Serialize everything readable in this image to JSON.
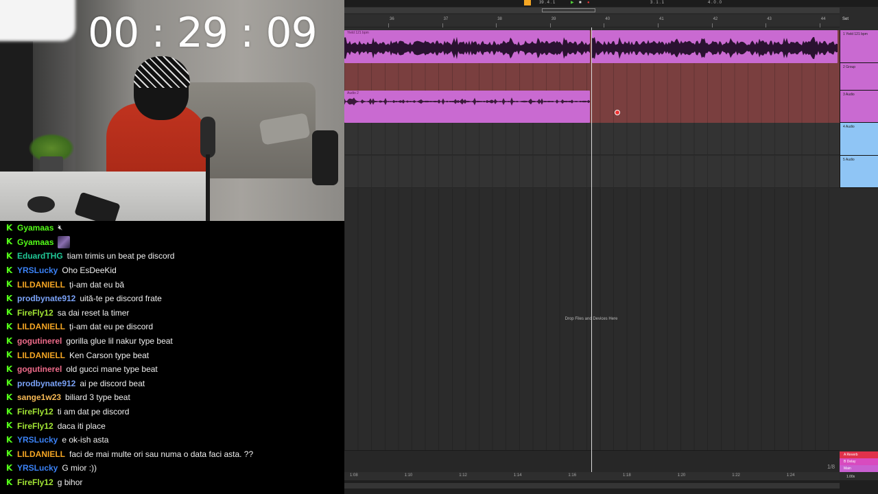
{
  "timer": "00 : 29 : 09",
  "chat": {
    "messages": [
      {
        "user": "Gyamaas",
        "color": "#53fc18",
        "text": "",
        "emote": "mute-icon"
      },
      {
        "user": "Gyamaas",
        "color": "#53fc18",
        "text": "",
        "emote": "emote-image"
      },
      {
        "user": "EduardTHG",
        "color": "#20c997",
        "text": "tiam trimis un beat pe discord"
      },
      {
        "user": "YRSLucky",
        "color": "#3b82f6",
        "text": "Oho EsDeeKid"
      },
      {
        "user": "LILDANIELL",
        "color": "#f5a623",
        "text": "ți-am dat eu bă"
      },
      {
        "user": "prodbynate912",
        "color": "#7aa2f7",
        "text": "uită-te pe discord frate"
      },
      {
        "user": "FireFly12",
        "color": "#a3e635",
        "text": "sa dai reset la timer"
      },
      {
        "user": "LILDANIELL",
        "color": "#f5a623",
        "text": "ți-am dat eu pe discord"
      },
      {
        "user": "gogutinerel",
        "color": "#ef6b8a",
        "text": "gorilla glue lil nakur type beat"
      },
      {
        "user": "LILDANIELL",
        "color": "#f5a623",
        "text": "Ken Carson type beat"
      },
      {
        "user": "gogutinerel",
        "color": "#ef6b8a",
        "text": "old gucci mane type beat"
      },
      {
        "user": "prodbynate912",
        "color": "#7aa2f7",
        "text": "ai pe discord beat"
      },
      {
        "user": "sange1w23",
        "color": "#f7b955",
        "text": "biliard 3 type beat"
      },
      {
        "user": "FireFly12",
        "color": "#a3e635",
        "text": "ti am dat pe discord"
      },
      {
        "user": "FireFly12",
        "color": "#a3e635",
        "text": "daca iti place"
      },
      {
        "user": "YRSLucky",
        "color": "#3b82f6",
        "text": "e ok-ish asta"
      },
      {
        "user": "LILDANIELL",
        "color": "#f5a623",
        "text": "faci de mai multe ori sau numa o data faci asta. ??"
      },
      {
        "user": "YRSLucky",
        "color": "#3b82f6",
        "text": "G mior :))"
      },
      {
        "user": "FireFly12",
        "color": "#a3e635",
        "text": "g bihor"
      }
    ]
  },
  "daw": {
    "transport": {
      "position": "39 . 4 . 1",
      "loop_start": "3 . 1 . 1",
      "loop_end": "4 . 0 . 0"
    },
    "ruler": [
      "36",
      "37",
      "38",
      "39",
      "40",
      "41",
      "42",
      "43",
      "44"
    ],
    "set_label": "Set",
    "tracks": [
      {
        "name": "1 Yield 121 bpm",
        "clip": "Yield 121 bpm",
        "color": "#c96ad1"
      },
      {
        "name": "2 Group",
        "clip": "",
        "color": "#c96ad1"
      },
      {
        "name": "3 Audio",
        "clip": "Audio 2",
        "color": "#c96ad1"
      },
      {
        "name": "4 Audio",
        "clip": "",
        "color": "#8fc5f5"
      },
      {
        "name": "5 Audio",
        "clip": "",
        "color": "#8fc5f5"
      }
    ],
    "drop_hint": "Drop Files and Devices Here",
    "return_tracks": [
      {
        "name": "A Reverb",
        "color": "#e0324b"
      },
      {
        "name": "B Delay",
        "color": "#d84bbf"
      },
      {
        "name": "Main",
        "color": "#c85fd0"
      }
    ],
    "bottom_ruler": [
      "1:08",
      "1:10",
      "1:12",
      "1:14",
      "1:16",
      "1:18",
      "1:20",
      "1:22",
      "1:24"
    ],
    "page_counter": "1/8",
    "zoom": "1.00x"
  }
}
